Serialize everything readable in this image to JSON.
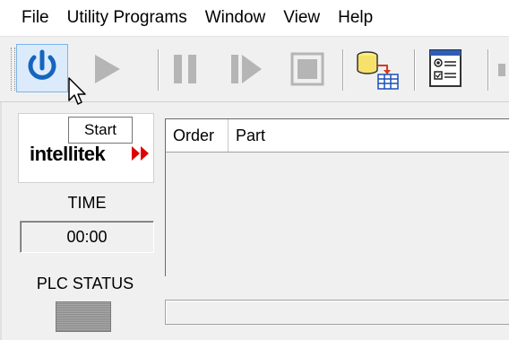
{
  "menu": {
    "items": [
      "File",
      "Utility Programs",
      "Window",
      "View",
      "Help"
    ]
  },
  "toolbar": {
    "buttons": [
      {
        "icon": "power-icon",
        "state": "hovered"
      },
      {
        "icon": "play-icon",
        "state": "disabled"
      },
      {
        "icon": "pause-icon",
        "state": "disabled"
      },
      {
        "icon": "step-icon",
        "state": "disabled"
      },
      {
        "icon": "stop-icon",
        "state": "disabled"
      },
      {
        "icon": "database-table-icon",
        "state": "enabled"
      },
      {
        "icon": "settings-form-icon",
        "state": "enabled"
      }
    ],
    "tooltip": "Start"
  },
  "panel": {
    "logo_text": "intellitek",
    "time_label": "TIME",
    "time_value": "00:00",
    "plc_label": "PLC STATUS"
  },
  "grid": {
    "columns": [
      "Order",
      "Part"
    ],
    "rows": []
  },
  "colors": {
    "power_blue": "#1565c0",
    "logo_red": "#e00000",
    "hover_bg": "#dcebfb",
    "disabled_gray": "#b5b5b5"
  }
}
